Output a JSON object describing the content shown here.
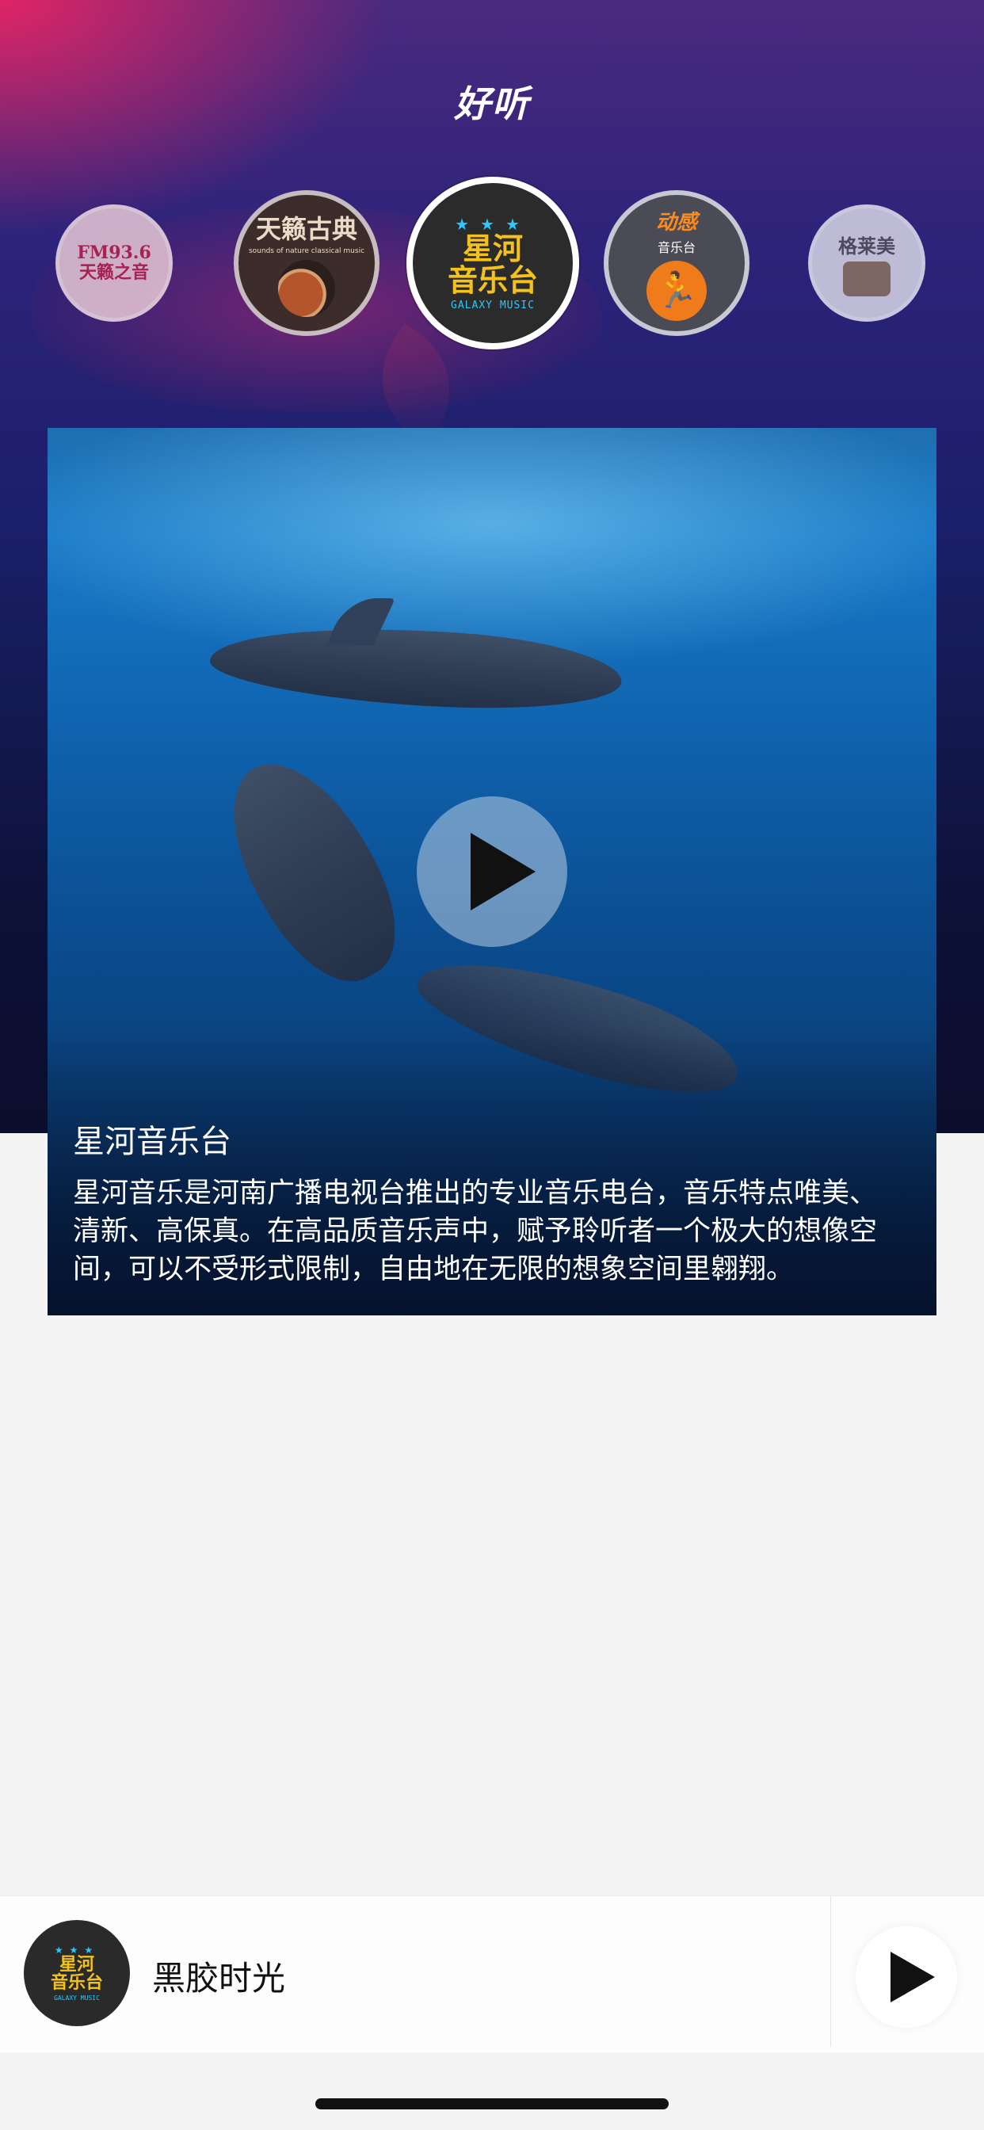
{
  "header": {
    "logo_text": "好听"
  },
  "stations": [
    {
      "name": "FM93.6",
      "subtitle": "天籁之音"
    },
    {
      "name": "天籁古典",
      "subtitle": "sounds of nature classical music"
    },
    {
      "name": "星河",
      "name2": "音乐台",
      "subtitle": "GALAXY MUSIC",
      "selected": true
    },
    {
      "name": "动感",
      "subtitle": "音乐台"
    },
    {
      "name": "格莱美"
    }
  ],
  "feature": {
    "title": "星河音乐台",
    "description": "星河音乐是河南广播电视台推出的专业音乐电台，音乐特点唯美、清新、高保真。在高品质音乐声中，赋予聆听者一个极大的想像空间，可以不受形式限制，自由地在无限的想象空间里翱翔。"
  },
  "player": {
    "song_title": "黑胶时光",
    "art_line1": "星河",
    "art_line2": "音乐台",
    "art_sub": "GALAXY MUSIC"
  },
  "colors": {
    "accent_yellow": "#f5c21b",
    "accent_cyan": "#29c8ff",
    "header_pink": "#e82464",
    "header_navy": "#1c1f6b"
  },
  "icons": {
    "play": "play-icon",
    "stars": "stars-icon"
  }
}
